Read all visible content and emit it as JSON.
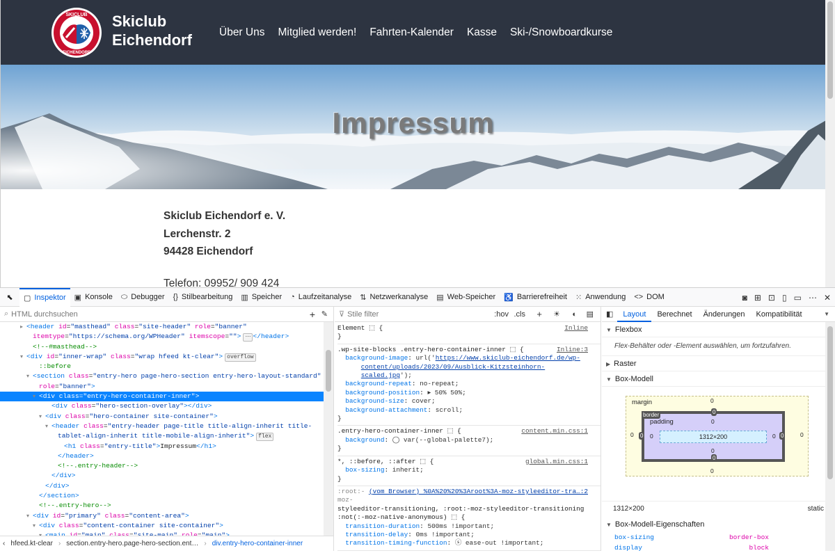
{
  "site": {
    "title_line1": "Skiclub",
    "title_line2": "Eichendorf",
    "logo_text_top": "SKICLUB",
    "logo_text_bottom": "EICHENDORF",
    "nav": [
      "Über Uns",
      "Mitglied werden!",
      "Fahrten-Kalender",
      "Kasse",
      "Ski-/Snowboardkurse"
    ],
    "hero_title": "Impressum",
    "address": [
      "Skiclub Eichendorf e. V.",
      "Lerchenstr. 2",
      "94428 Eichendorf"
    ],
    "phone": "Telefon: 09952/ 909 424"
  },
  "devtools": {
    "tabs": [
      {
        "icon": "▢",
        "label": "Inspektor",
        "name": "inspector"
      },
      {
        "icon": "▣",
        "label": "Konsole",
        "name": "console"
      },
      {
        "icon": "⬭",
        "label": "Debugger",
        "name": "debugger"
      },
      {
        "icon": "{}",
        "label": "Stilbearbeitung",
        "name": "style-editor"
      },
      {
        "icon": "▥",
        "label": "Speicher",
        "name": "memory"
      },
      {
        "icon": "◔",
        "label": "Laufzeitanalyse",
        "name": "performance"
      },
      {
        "icon": "⇅",
        "label": "Netzwerkanalyse",
        "name": "network"
      },
      {
        "icon": "▤",
        "label": "Web-Speicher",
        "name": "storage"
      },
      {
        "icon": "♿",
        "label": "Barrierefreiheit",
        "name": "accessibility"
      },
      {
        "icon": "⁙",
        "label": "Anwendung",
        "name": "application"
      },
      {
        "icon": "<>",
        "label": "DOM",
        "name": "dom"
      }
    ],
    "search_placeholder": "HTML durchsuchen",
    "filter_placeholder": "Stile filter",
    "hov": ":hov",
    "cls": ".cls",
    "markup": [
      {
        "indent": 3,
        "tw": "▸",
        "html": "<span class=\"tg\">&lt;header</span> <span class=\"at\">id</span>=<span class=\"av\">\"masthead\"</span> <span class=\"at\">class</span>=<span class=\"av\">\"site-header\"</span> <span class=\"at\">role</span>=<span class=\"av\">\"banner\"</span>"
      },
      {
        "indent": 4,
        "tw": "",
        "html": "<span class=\"at\">itemtype</span>=<span class=\"av\">\"https://schema.org/WPHeader\"</span> <span class=\"at\">itemscope</span>=<span class=\"av\">\"\"</span><span class=\"tg\">&gt;</span><span class=\"badge\">⋯</span><span class=\"tg\">&lt;/header&gt;</span>"
      },
      {
        "indent": 4,
        "tw": "",
        "html": "<span class=\"cm\">&lt;!--#masthead--&gt;</span>"
      },
      {
        "indent": 3,
        "tw": "▾",
        "html": "<span class=\"tg\">&lt;div</span> <span class=\"at\">id</span>=<span class=\"av\">\"inner-wrap\"</span> <span class=\"at\">class</span>=<span class=\"av\">\"wrap hfeed kt-clear\"</span><span class=\"tg\">&gt;</span><span class=\"badge\">overflow</span>"
      },
      {
        "indent": 5,
        "tw": "",
        "html": "<span class=\"cm\">::before</span>"
      },
      {
        "indent": 4,
        "tw": "▾",
        "html": "<span class=\"tg\">&lt;section</span> <span class=\"at\">class</span>=<span class=\"av\">\"entry-hero page-hero-section entry-hero-layout-standard\"</span>"
      },
      {
        "indent": 5,
        "tw": "",
        "html": "<span class=\"at\">role</span>=<span class=\"av\">\"banner\"</span><span class=\"tg\">&gt;</span>"
      },
      {
        "indent": 5,
        "tw": "▾",
        "sel": true,
        "html": "<span class=\"tg\">&lt;div</span> <span class=\"at\">class</span>=<span class=\"av\">\"entry-hero-container-inner\"</span><span class=\"tg\">&gt;</span>"
      },
      {
        "indent": 7,
        "tw": "",
        "html": "<span class=\"tg\">&lt;div</span> <span class=\"at\">class</span>=<span class=\"av\">\"hero-section-overlay\"</span><span class=\"tg\">&gt;&lt;/div&gt;</span>"
      },
      {
        "indent": 6,
        "tw": "▾",
        "html": "<span class=\"tg\">&lt;div</span> <span class=\"at\">class</span>=<span class=\"av\">\"hero-container site-container\"</span><span class=\"tg\">&gt;</span>"
      },
      {
        "indent": 7,
        "tw": "▾",
        "html": "<span class=\"tg\">&lt;header</span> <span class=\"at\">class</span>=<span class=\"av\">\"entry-header page-title title-align-inherit title-</span>"
      },
      {
        "indent": 8,
        "tw": "",
        "html": "<span class=\"av\">tablet-align-inherit title-mobile-align-inherit\"</span><span class=\"tg\">&gt;</span><span class=\"badge\">flex</span>"
      },
      {
        "indent": 9,
        "tw": "",
        "html": "<span class=\"tg\">&lt;h1</span> <span class=\"at\">class</span>=<span class=\"av\">\"entry-title\"</span><span class=\"tg\">&gt;</span>Impressum<span class=\"tg\">&lt;/h1&gt;</span>"
      },
      {
        "indent": 8,
        "tw": "",
        "html": "<span class=\"tg\">&lt;/header&gt;</span>"
      },
      {
        "indent": 8,
        "tw": "",
        "html": "<span class=\"cm\">&lt;!--.entry-header--&gt;</span>"
      },
      {
        "indent": 7,
        "tw": "",
        "html": "<span class=\"tg\">&lt;/div&gt;</span>"
      },
      {
        "indent": 6,
        "tw": "",
        "html": "<span class=\"tg\">&lt;/div&gt;</span>"
      },
      {
        "indent": 5,
        "tw": "",
        "html": "<span class=\"tg\">&lt;/section&gt;</span>"
      },
      {
        "indent": 5,
        "tw": "",
        "html": "<span class=\"cm\">&lt;!--.entry-hero--&gt;</span>"
      },
      {
        "indent": 4,
        "tw": "▾",
        "html": "<span class=\"tg\">&lt;div</span> <span class=\"at\">id</span>=<span class=\"av\">\"primary\"</span> <span class=\"at\">class</span>=<span class=\"av\">\"content-area\"</span><span class=\"tg\">&gt;</span>"
      },
      {
        "indent": 5,
        "tw": "▾",
        "html": "<span class=\"tg\">&lt;div</span> <span class=\"at\">class</span>=<span class=\"av\">\"content-container site-container\"</span><span class=\"tg\">&gt;</span>"
      },
      {
        "indent": 6,
        "tw": "▾",
        "html": "<span class=\"tg\">&lt;main</span> <span class=\"at\">id</span>=<span class=\"av\">\"main\"</span> <span class=\"at\">class</span>=<span class=\"av\">\"site-main\"</span> <span class=\"at\">role</span>=<span class=\"av\">\"main\"</span><span class=\"tg\">&gt;</span>"
      }
    ],
    "breadcrumbs": [
      "hfeed.kt-clear",
      "section.entry-hero.page-hero-section.ent…",
      "div.entry-hero-container-inner"
    ],
    "rules": [
      {
        "src": "Inline",
        "lines": [
          "<span class=\"sel-t\">Element ⬚ {</span>",
          "<span class=\"sel-t\">}</span>"
        ]
      },
      {
        "src": "Inline:3",
        "lines": [
          "<span class=\"sel-t\">.wp-site-blocks .entry-hero-container-inner ⬚ {</span>",
          "&nbsp;&nbsp;<span class=\"prop\">background-image</span>: <span class=\"val\">url('</span><span class=\"url\">https://www.skiclub-eichendorf.de/wp-</span>",
          "&nbsp;&nbsp;&nbsp;&nbsp;&nbsp;&nbsp;<span class=\"url\">content/uploads/2023/09/Ausblick-Kitzsteinhorn-</span>",
          "&nbsp;&nbsp;&nbsp;&nbsp;&nbsp;&nbsp;<span class=\"url\">scaled.jpg</span><span class=\"val\">');</span>",
          "&nbsp;&nbsp;<span class=\"prop\">background-repeat</span>: <span class=\"val\">no-repeat;</span>",
          "&nbsp;&nbsp;<span class=\"prop\">background-position</span>: <span class=\"val\">▸ 50% 50%;</span>",
          "&nbsp;&nbsp;<span class=\"prop\">background-size</span>: <span class=\"val\">cover;</span>",
          "&nbsp;&nbsp;<span class=\"prop\">background-attachment</span>: <span class=\"val\">scroll;</span>",
          "<span class=\"sel-t\">}</span>"
        ]
      },
      {
        "src": "content.min.css:1",
        "lines": [
          "<span class=\"sel-t\">.entry-hero-container-inner ⬚ {</span>",
          "&nbsp;&nbsp;<span class=\"prop\">background</span>: <span class=\"val\">◯ var(--global-palette7);</span>",
          "<span class=\"sel-t\">}</span>"
        ]
      },
      {
        "src": "global.min.css:1",
        "lines": [
          "<span class=\"sel-t\">*, ::before, ::after ⬚ {</span>",
          "&nbsp;&nbsp;<span class=\"prop\">box-sizing</span>: <span class=\"val\">inherit;</span>",
          "<span class=\"sel-t\">}</span>"
        ]
      },
      {
        "src": "(vom Browser) %0A%20%20%3Aroot%3A-moz-styleeditor-tra…:2",
        "lines": [
          "<span class=\"sel-t\" style=\"color:#888\">:root:-</span>",
          "<span class=\"sel-t\" style=\"color:#888\">moz-</span>",
          "<span class=\"sel-t\">styleeditor-transitioning, :root:-moz-styleeditor-transitioning</span>",
          "<span class=\"sel-t\">:not(:-moz-native-anonymous) ⬚ {</span>",
          "&nbsp;&nbsp;<span class=\"prop\">transition-duration</span>: <span class=\"val\">500ms !important;</span>",
          "&nbsp;&nbsp;<span class=\"prop\">transition-delay</span>: <span class=\"val\">0ms !important;</span>",
          "&nbsp;&nbsp;<span class=\"prop\">transition-timing-function</span>: <span class=\"val\">ⓢ ease-out !important;</span>"
        ]
      }
    ],
    "layout_tabs": [
      "Layout",
      "Berechnet",
      "Änderungen",
      "Kompatibilität"
    ],
    "flexbox_label": "Flexbox",
    "flexbox_hint": "Flex-Behälter oder -Element auswählen, um fortzufahren.",
    "grid_label": "Raster",
    "boxmodel_label": "Box-Modell",
    "bm": {
      "margin": "margin",
      "border": "border",
      "padding": "padding",
      "content": "1312×200",
      "zero": "0"
    },
    "bm_size": "1312×200",
    "bm_position": "static",
    "props_label": "Box-Modell-Eigenschaften",
    "props": [
      {
        "k": "box-sizing",
        "v": "border-box"
      },
      {
        "k": "display",
        "v": "block"
      }
    ]
  }
}
